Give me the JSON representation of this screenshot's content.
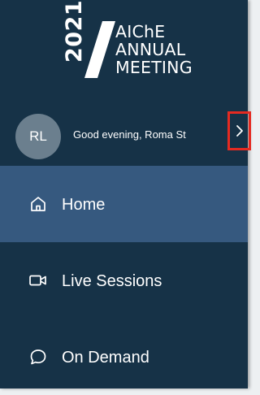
{
  "logo": {
    "year": "2021",
    "lines": [
      "AIChE",
      "ANNUAL",
      "MEETING"
    ]
  },
  "user": {
    "initials": "RL",
    "greeting": "Good evening, Roma St",
    "expand_icon": "chevron-right-icon"
  },
  "nav": {
    "items": [
      {
        "label": "Home",
        "icon": "home-icon",
        "active": true
      },
      {
        "label": "Live Sessions",
        "icon": "video-camera-icon",
        "active": false
      },
      {
        "label": "On Demand",
        "icon": "chat-bubble-icon",
        "active": false
      }
    ]
  },
  "colors": {
    "sidebar_bg": "#163247",
    "active_item_bg": "#36597f",
    "avatar_bg": "#6b7f8e",
    "highlight_border": "#e52a21"
  }
}
